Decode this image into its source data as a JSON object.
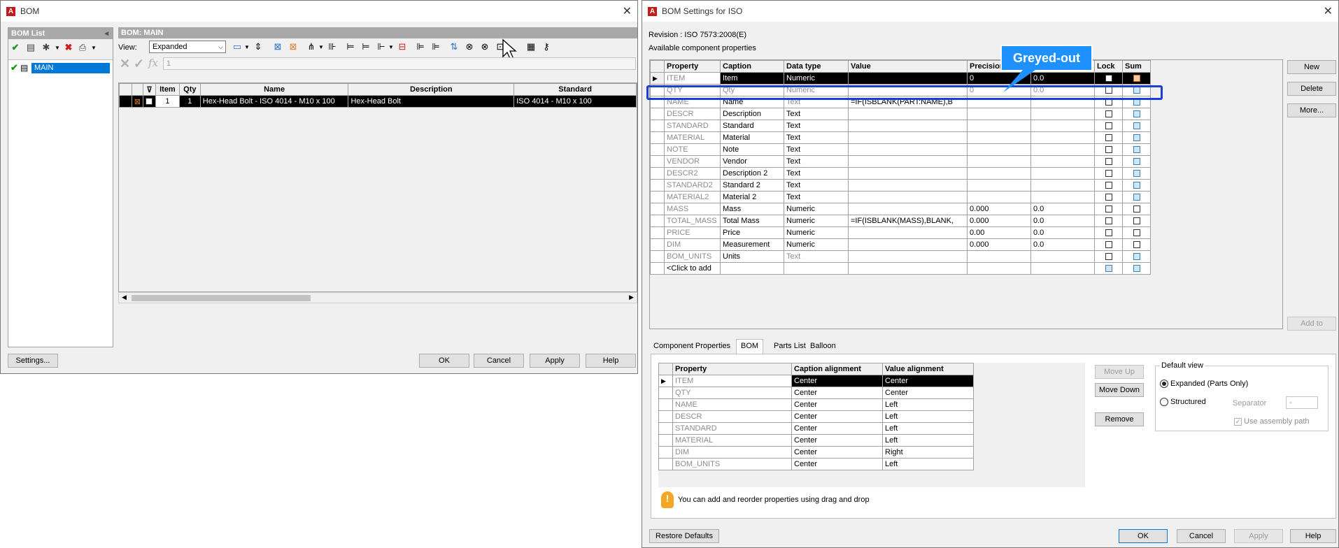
{
  "bom_window": {
    "title": "BOM",
    "bom_list_header": "BOM List",
    "tree_item": "MAIN",
    "main_header": "BOM: MAIN",
    "view_label": "View:",
    "view_value": "Expanded",
    "formula_value": "1",
    "columns": [
      "Item",
      "Qty",
      "Name",
      "Description",
      "Standard"
    ],
    "row": {
      "item": "1",
      "qty": "1",
      "name": "Hex-Head Bolt - ISO 4014 - M10 x 100",
      "description": "Hex-Head Bolt",
      "standard": "ISO 4014 - M10 x 100"
    },
    "buttons": {
      "settings": "Settings...",
      "ok": "OK",
      "cancel": "Cancel",
      "apply": "Apply",
      "help": "Help"
    }
  },
  "settings_window": {
    "title": "BOM Settings for ISO",
    "revision": "Revision : ISO 7573:2008(E)",
    "available_label": "Available component properties",
    "columns": [
      "Property",
      "Caption",
      "Data type",
      "Value",
      "Precision",
      "",
      "Lock",
      "Sum"
    ],
    "properties": [
      {
        "property": "ITEM",
        "caption": "Item",
        "datatype": "Numeric",
        "value": "",
        "precision": "0",
        "precision2": "0.0",
        "sum": "orange"
      },
      {
        "property": "QTY",
        "caption": "Qty",
        "datatype": "Numeric",
        "value": "",
        "precision": "0",
        "precision2": "0.0",
        "sum": "blue"
      },
      {
        "property": "NAME",
        "caption": "Name",
        "datatype": "Text",
        "value": "=IF(ISBLANK(PART:NAME),B",
        "precision": "",
        "precision2": "",
        "sum": "blue"
      },
      {
        "property": "DESCR",
        "caption": "Description",
        "datatype": "Text",
        "value": "",
        "precision": "",
        "precision2": "",
        "sum": "blue"
      },
      {
        "property": "STANDARD",
        "caption": "Standard",
        "datatype": "Text",
        "value": "",
        "precision": "",
        "precision2": "",
        "sum": "blue"
      },
      {
        "property": "MATERIAL",
        "caption": "Material",
        "datatype": "Text",
        "value": "",
        "precision": "",
        "precision2": "",
        "sum": "blue"
      },
      {
        "property": "NOTE",
        "caption": "Note",
        "datatype": "Text",
        "value": "",
        "precision": "",
        "precision2": "",
        "sum": "blue"
      },
      {
        "property": "VENDOR",
        "caption": "Vendor",
        "datatype": "Text",
        "value": "",
        "precision": "",
        "precision2": "",
        "sum": "blue"
      },
      {
        "property": "DESCR2",
        "caption": "Description 2",
        "datatype": "Text",
        "value": "",
        "precision": "",
        "precision2": "",
        "sum": "blue"
      },
      {
        "property": "STANDARD2",
        "caption": "Standard 2",
        "datatype": "Text",
        "value": "",
        "precision": "",
        "precision2": "",
        "sum": "blue"
      },
      {
        "property": "MATERIAL2",
        "caption": "Material 2",
        "datatype": "Text",
        "value": "",
        "precision": "",
        "precision2": "",
        "sum": "blue"
      },
      {
        "property": "MASS",
        "caption": "Mass",
        "datatype": "Numeric",
        "value": "",
        "precision": "0.000",
        "precision2": "0.0",
        "sum": "white"
      },
      {
        "property": "TOTAL_MASS",
        "caption": "Total Mass",
        "datatype": "Numeric",
        "value": "=IF(ISBLANK(MASS),BLANK,",
        "precision": "0.000",
        "precision2": "0.0",
        "sum": "white"
      },
      {
        "property": "PRICE",
        "caption": "Price",
        "datatype": "Numeric",
        "value": "",
        "precision": "0.00",
        "precision2": "0.0",
        "sum": "white"
      },
      {
        "property": "DIM",
        "caption": "Measurement",
        "datatype": "Numeric",
        "value": "",
        "precision": "0.000",
        "precision2": "0.0",
        "sum": "white"
      },
      {
        "property": "BOM_UNITS",
        "caption": "Units",
        "datatype": "Text",
        "value": "",
        "precision": "",
        "precision2": "",
        "sum": "blue"
      }
    ],
    "click_to_add": "<Click to add",
    "side_buttons": {
      "new": "New",
      "delete": "Delete",
      "more": "More...",
      "add_to": "Add to"
    },
    "callout": "Greyed-out",
    "tabs": [
      "Component Properties",
      "BOM",
      "Parts List",
      "Balloon"
    ],
    "active_tab": "BOM",
    "bom_columns": [
      "Property",
      "Caption alignment",
      "Value alignment"
    ],
    "bom_rows": [
      {
        "property": "ITEM",
        "caption": "Center",
        "value": "Center"
      },
      {
        "property": "QTY",
        "caption": "Center",
        "value": "Center"
      },
      {
        "property": "NAME",
        "caption": "Center",
        "value": "Left"
      },
      {
        "property": "DESCR",
        "caption": "Center",
        "value": "Left"
      },
      {
        "property": "STANDARD",
        "caption": "Center",
        "value": "Left"
      },
      {
        "property": "MATERIAL",
        "caption": "Center",
        "value": "Left"
      },
      {
        "property": "DIM",
        "caption": "Center",
        "value": "Right"
      },
      {
        "property": "BOM_UNITS",
        "caption": "Center",
        "value": "Left"
      }
    ],
    "move_buttons": {
      "up": "Move Up",
      "down": "Move Down",
      "remove": "Remove"
    },
    "default_view": {
      "legend": "Default view",
      "expanded": "Expanded (Parts Only)",
      "structured": "Structured",
      "separator_label": "Separator",
      "separator_value": "-",
      "use_assembly_path": "Use assembly path"
    },
    "hint": "You can add and reorder properties using drag and drop",
    "buttons": {
      "restore": "Restore Defaults",
      "ok": "OK",
      "cancel": "Cancel",
      "apply": "Apply",
      "help": "Help"
    }
  },
  "colors": {
    "accent_blue": "#1a3fd6",
    "callout_blue": "#1e90ff",
    "header_grey": "#a8a8a8"
  }
}
